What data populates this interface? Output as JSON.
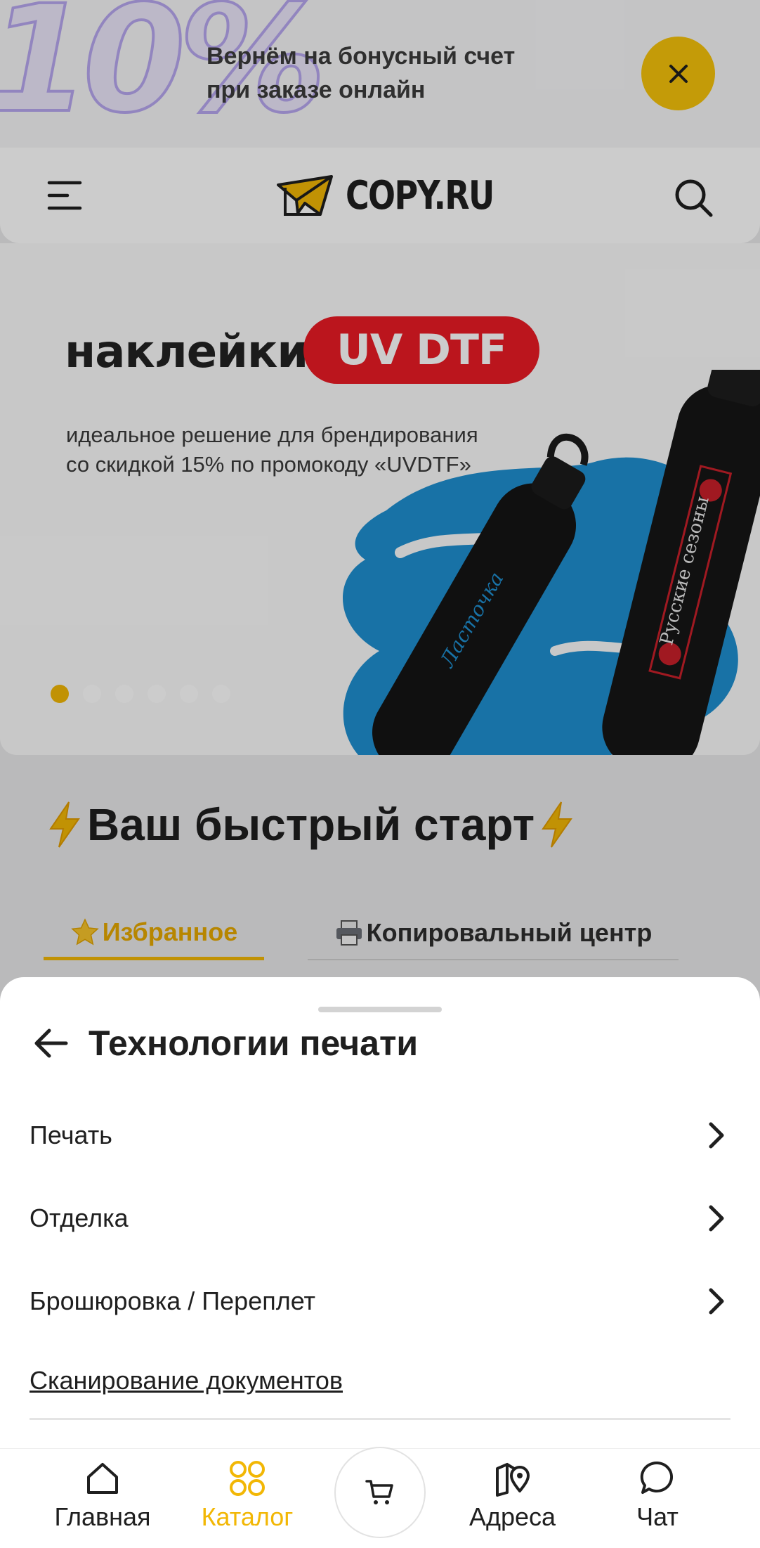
{
  "promo": {
    "big_text": "10%",
    "text_line1": "Вернём на бонусный счет",
    "text_line2": "при заказе онлайн",
    "close_icon": "close-icon",
    "accent": "#f6c20a"
  },
  "header": {
    "menu_icon": "hamburger-menu-icon",
    "logo_text": "COPY.RU",
    "search_icon": "search-icon"
  },
  "banner": {
    "headline_word": "наклейки",
    "headline_pill": "UV DTF",
    "subtitle_line1": "идеальное решение для брендирования",
    "subtitle_line2": "со скидкой 15% по промокоду «UVDTF»",
    "bottle_left_label": "Ласточка",
    "bottle_right_label": "Русские сезоны",
    "slides_total": 6,
    "active_slide": 1,
    "pill_color": "#ea1b25"
  },
  "quick_start": {
    "title": "Ваш быстрый старт",
    "tabs": [
      {
        "label": "Избранное",
        "icon": "star-icon",
        "active": true
      },
      {
        "label": "Копировальный центр",
        "icon": "printer-icon",
        "active": false
      }
    ]
  },
  "sheet": {
    "back_icon": "arrow-left-icon",
    "title": "Технологии печати",
    "items": [
      {
        "label": "Печать",
        "has_submenu": true
      },
      {
        "label": "Отделка",
        "has_submenu": true
      },
      {
        "label": "Брошюровка / Переплет",
        "has_submenu": true
      },
      {
        "label": "Сканирование документов",
        "has_submenu": false
      }
    ]
  },
  "bottom_nav": {
    "items": [
      {
        "label": "Главная",
        "icon": "home-icon",
        "active": false
      },
      {
        "label": "Каталог",
        "icon": "catalog-grid-icon",
        "active": true
      },
      {
        "label": "Адреса",
        "icon": "map-pin-icon",
        "active": false
      },
      {
        "label": "Чат",
        "icon": "chat-bubble-icon",
        "active": false
      }
    ],
    "cart_icon": "cart-icon",
    "accent": "#f2b705"
  }
}
